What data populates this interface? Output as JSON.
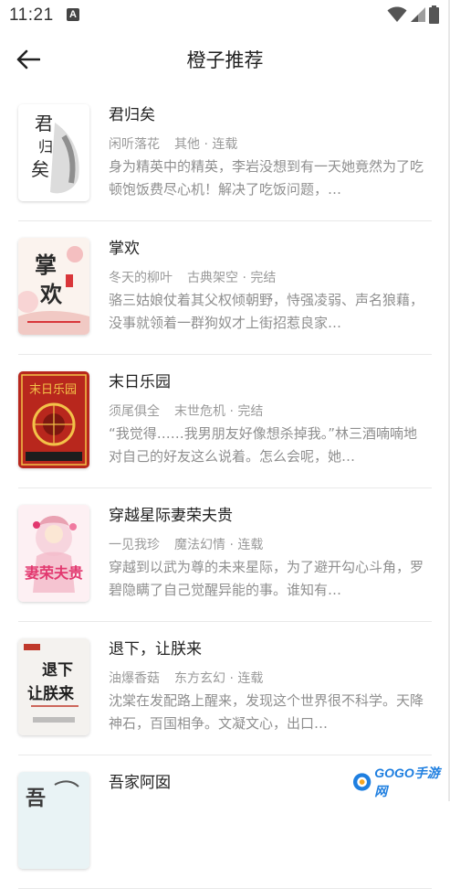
{
  "status_bar": {
    "time": "11:21",
    "notification_letter": "A"
  },
  "header": {
    "title": "橙子推荐"
  },
  "books": [
    {
      "title": "君归矣",
      "author": "闲听落花",
      "category": "其他 · 连载",
      "description": "身为精英中的精英，李岩没想到有一天她竟然为了吃顿饱饭费尽心机！解决了吃饭问题，…",
      "cover_text": "君归矣",
      "cover_bg": "#ffffff",
      "cover_accent": "#2b2b2b"
    },
    {
      "title": "掌欢",
      "author": "冬天的柳叶",
      "category": "古典架空 · 完结",
      "description": "骆三姑娘仗着其父权倾朝野，恃强凌弱、声名狼藉，没事就领着一群狗奴才上街招惹良家…",
      "cover_text": "掌欢",
      "cover_bg": "#fbf3ee",
      "cover_accent": "#d9363a"
    },
    {
      "title": "末日乐园",
      "author": "须尾俱全",
      "category": "末世危机 · 完结",
      "description": "“我觉得……我男朋友好像想杀掉我。”林三酒喃喃地对自己的好友这么说着。怎么会呢，她…",
      "cover_text": "末日乐园",
      "cover_bg": "#b8271d",
      "cover_accent": "#f3c248"
    },
    {
      "title": "穿越星际妻荣夫贵",
      "author": "一见我珍",
      "category": "魔法幻情 · 连载",
      "description": "穿越到以武为尊的未来星际，为了避开勾心斗角，罗碧隐瞒了自己觉醒异能的事。谁知有…",
      "cover_text": "妻荣夫贵",
      "cover_bg": "#fdf0f3",
      "cover_accent": "#e2386f"
    },
    {
      "title": "退下，让朕来",
      "author": "油爆香菇",
      "category": "东方玄幻 · 连载",
      "description": "沈棠在发配路上醒来，发现这个世界很不科学。天降神石，百国相争。文凝文心，出口…",
      "cover_text": "退下让朕来",
      "cover_bg": "#f4f2ef",
      "cover_accent": "#1e1e1e"
    },
    {
      "title": "吾家阿囡",
      "author": "",
      "category": "",
      "description": "",
      "cover_text": "吾",
      "cover_bg": "#e9f3f5",
      "cover_accent": "#3a3a3a"
    }
  ],
  "watermark": {
    "text": "GOGO手游网"
  },
  "colors": {
    "title": "#222222",
    "meta": "#9a9a9a",
    "divider": "#e9e9e9",
    "watermark": "#1f7fe0"
  }
}
